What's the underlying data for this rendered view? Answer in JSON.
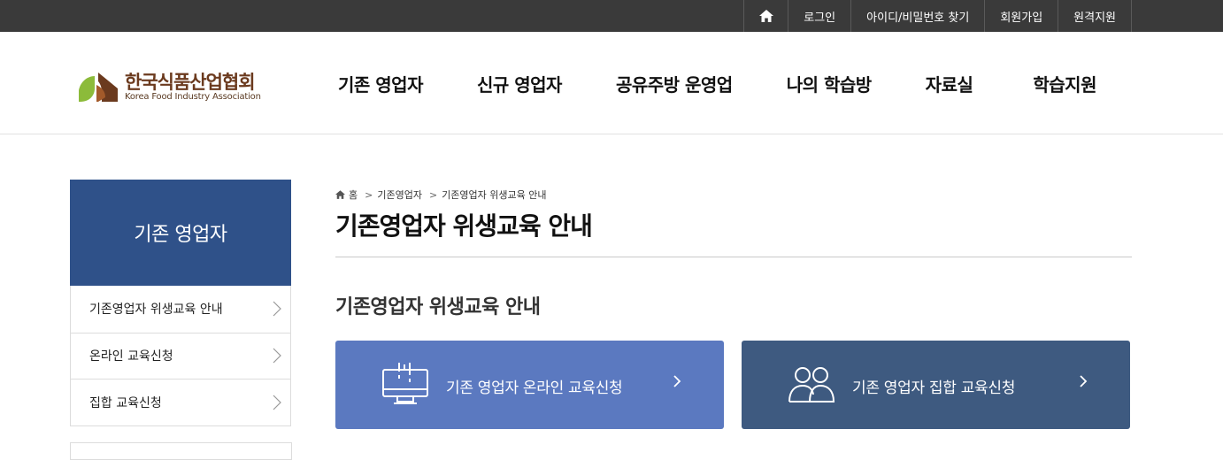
{
  "topbar": {
    "home_icon": "home-icon",
    "links": [
      "로그인",
      "아이디/비밀번호 찾기",
      "회원가입",
      "원격지원"
    ]
  },
  "logo": {
    "name_ko": "한국식품산업협회",
    "name_en": "Korea Food Industry Association",
    "colors": {
      "green": "#8cbb3a",
      "brown": "#6b3a1e"
    }
  },
  "gnb": [
    "기존 영업자",
    "신규 영업자",
    "공유주방 운영업",
    "나의 학습방",
    "자료실",
    "학습지원"
  ],
  "side": {
    "title": "기존 영업자",
    "items": [
      "기존영업자 위생교육 안내",
      "온라인 교육신청",
      "집합 교육신청"
    ]
  },
  "breadcrumb": [
    "홈",
    "기존영업자",
    "기존영업자 위생교육 안내"
  ],
  "page_title": "기존영업자 위생교육 안내",
  "section_title": "기존영업자 위생교육 안내",
  "cards": {
    "online": {
      "label": "기존 영업자 온라인 교육신청",
      "icon": "monitor-icon",
      "color": "#5b79c0"
    },
    "group": {
      "label": "기존 영업자 집합 교육신청",
      "icon": "people-icon",
      "color": "#3e5a80"
    }
  },
  "colors": {
    "topbar": "#3a3a3a",
    "side_title": "#2f5189"
  }
}
